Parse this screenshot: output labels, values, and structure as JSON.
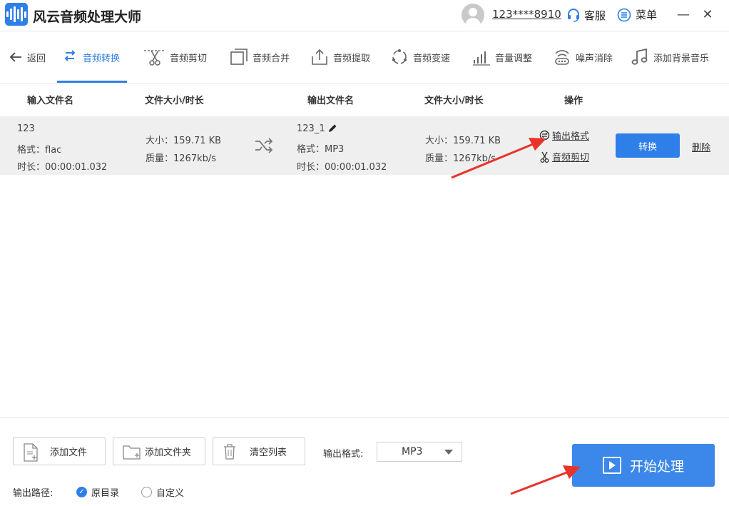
{
  "app": {
    "title": "风云音频处理大师",
    "user": "123****8910",
    "service_label": "客服",
    "menu_label": "菜单",
    "min_label": "—",
    "close_label": "✕"
  },
  "toolbar": {
    "back": "返回",
    "items": [
      {
        "label": "音频转换",
        "icon": "convert-icon",
        "active": true
      },
      {
        "label": "音频剪切",
        "icon": "cut-icon"
      },
      {
        "label": "音频合并",
        "icon": "merge-icon"
      },
      {
        "label": "音频提取",
        "icon": "extract-icon"
      },
      {
        "label": "音频变速",
        "icon": "speed-icon"
      },
      {
        "label": "音量调整",
        "icon": "volume-icon"
      },
      {
        "label": "噪声消除",
        "icon": "noise-icon"
      },
      {
        "label": "添加背景音乐",
        "icon": "music-icon"
      }
    ]
  },
  "table": {
    "headers": {
      "input_name": "输入文件名",
      "input_size": "文件大小/时长",
      "output_name": "输出文件名",
      "output_size": "文件大小/时长",
      "actions": "操作"
    },
    "rows": [
      {
        "input_name": "123",
        "input_format": "格式：flac",
        "input_duration": "时长：00:00:01.032",
        "input_size": "大小：159.71 KB",
        "input_quality": "质量：1267kb/s",
        "output_name": "123_1",
        "output_format": "格式：MP3",
        "output_duration": "时长：00:00:01.032",
        "output_size": "大小：159.71 KB",
        "output_quality": "质量：1267kb/s",
        "action_format": "输出格式",
        "action_cut": "音频剪切",
        "convert": "转换",
        "delete": "删除"
      }
    ]
  },
  "bottom": {
    "add_file": "添加文件",
    "add_folder": "添加文件夹",
    "clear_list": "清空列表",
    "format_label": "输出格式:",
    "format_value": "MP3",
    "path_label": "输出路径:",
    "path_original": "原目录",
    "path_custom": "自定义",
    "start": "开始处理"
  },
  "colors": {
    "accent": "#2f7fe8",
    "annotation_arrow": "#e8332a"
  }
}
